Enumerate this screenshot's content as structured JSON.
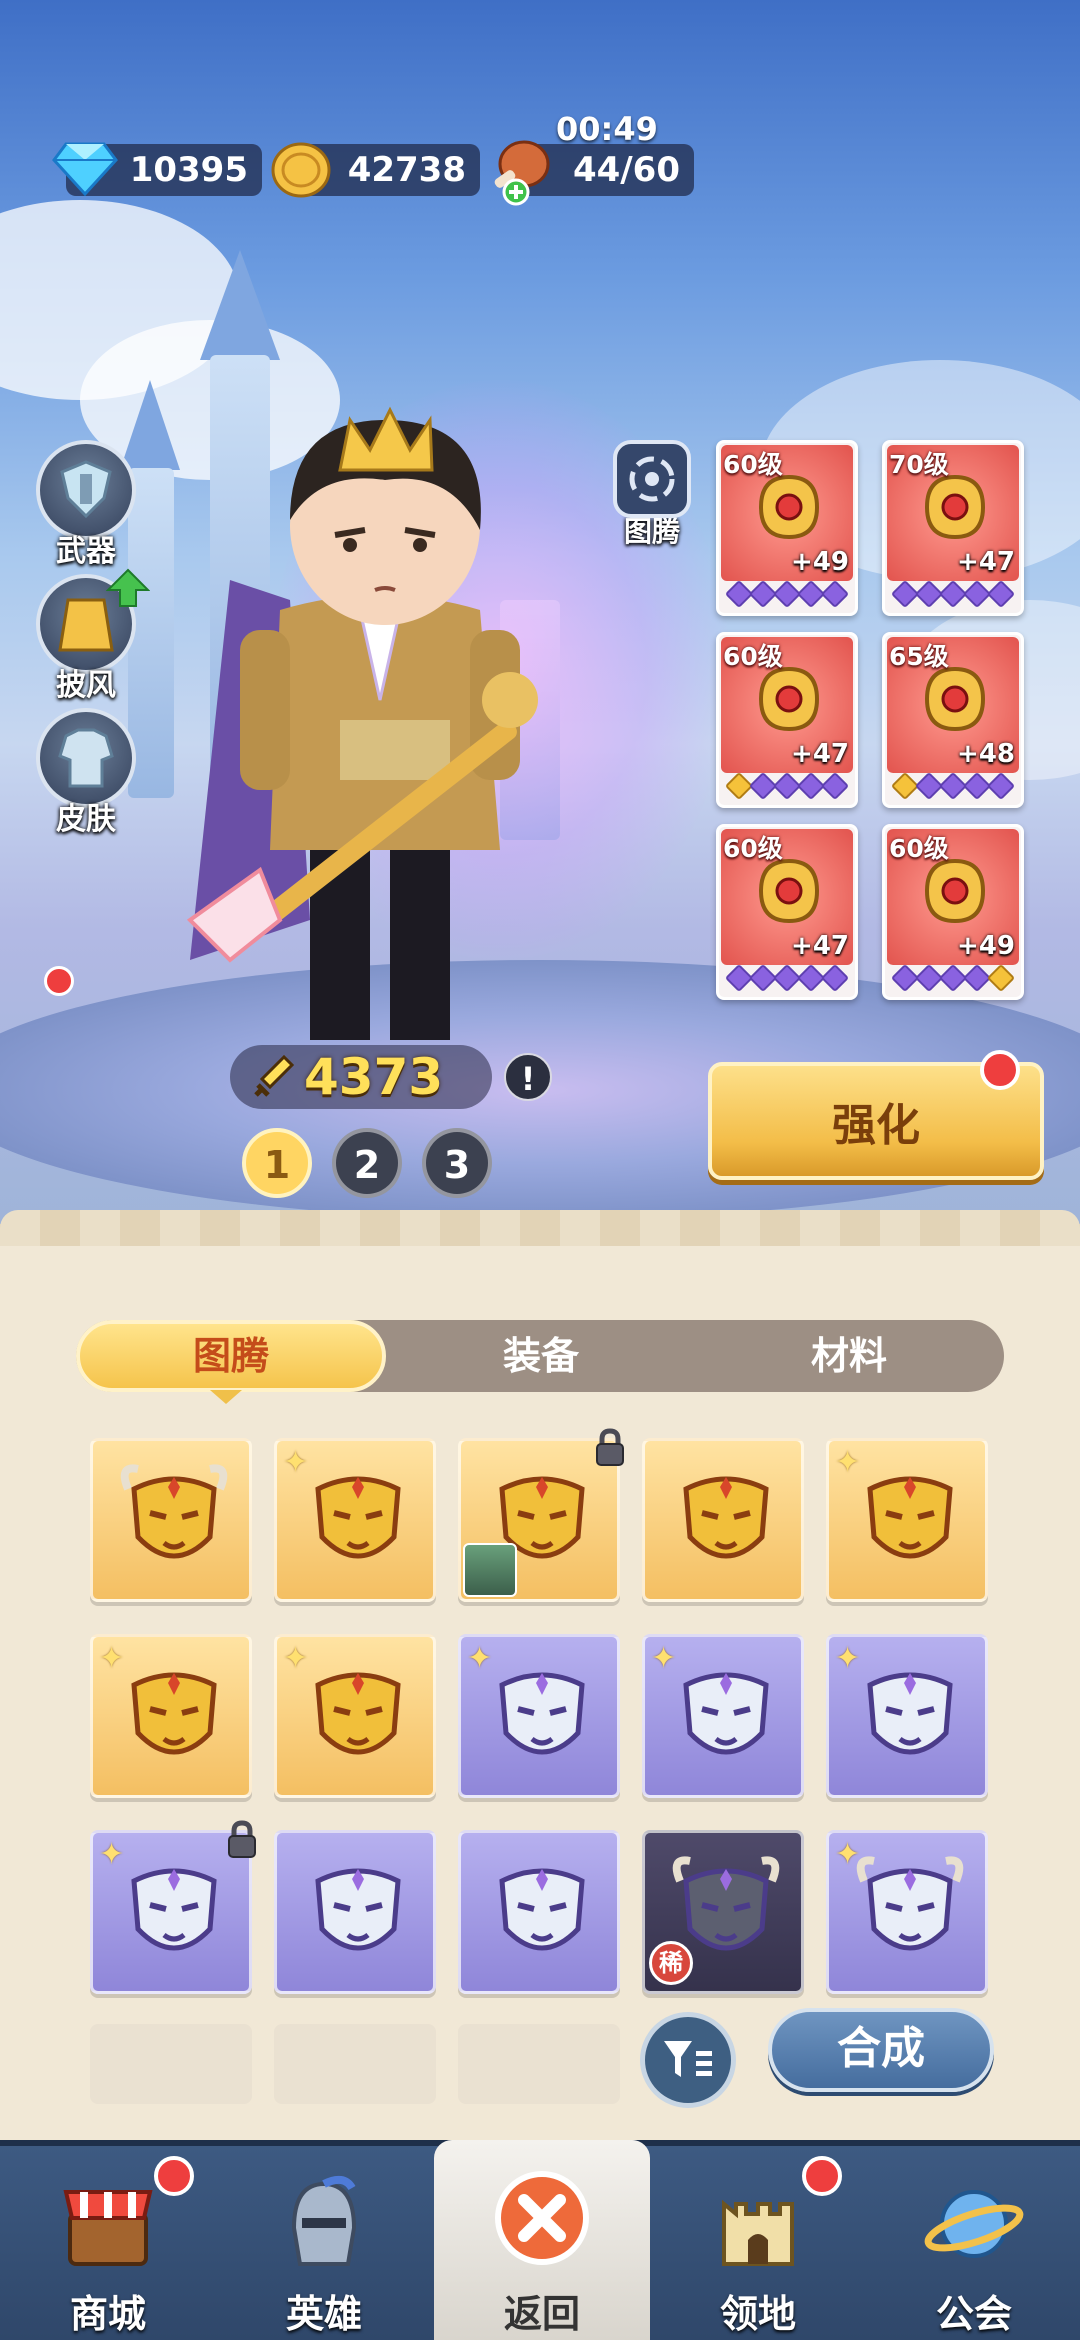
{
  "resources": {
    "gems": "10395",
    "coins": "42738",
    "stamina": "44/60",
    "stamina_timer": "00:49"
  },
  "side_menu": [
    {
      "label": "武器"
    },
    {
      "label": "披风"
    },
    {
      "label": "皮肤"
    }
  ],
  "totem_button": {
    "label": "图腾"
  },
  "equip_slots": [
    {
      "level": "60级",
      "plus": "+49",
      "pips": [
        "p",
        "p",
        "p",
        "p",
        "p"
      ],
      "icon": "jeweled-shoulder-icon"
    },
    {
      "level": "70级",
      "plus": "+47",
      "pips": [
        "p",
        "p",
        "p",
        "p",
        "p"
      ],
      "icon": "ruby-ring-icon"
    },
    {
      "level": "60级",
      "plus": "+47",
      "pips": [
        "g",
        "p",
        "p",
        "p",
        "p"
      ],
      "icon": "golden-crown-icon"
    },
    {
      "level": "65级",
      "plus": "+48",
      "pips": [
        "g",
        "p",
        "p",
        "p",
        "p"
      ],
      "icon": "golden-horn-icon"
    },
    {
      "level": "60级",
      "plus": "+47",
      "pips": [
        "p",
        "p",
        "p",
        "p",
        "p"
      ],
      "icon": "golden-boots-icon"
    },
    {
      "level": "60级",
      "plus": "+49",
      "pips": [
        "p",
        "p",
        "p",
        "p",
        "g"
      ],
      "icon": "golden-armor-icon"
    }
  ],
  "power": "4373",
  "info_mark": "!",
  "pages": [
    "1",
    "2",
    "3"
  ],
  "strengthen_label": "强化",
  "tabs": [
    "图腾",
    "装备",
    "材料"
  ],
  "inventory": [
    {
      "style": "gold",
      "star": false,
      "lock": false,
      "icon": "bull-skull-mask-icon"
    },
    {
      "style": "gold",
      "star": true,
      "lock": false,
      "icon": "phoenix-mask-icon"
    },
    {
      "style": "gold",
      "star": false,
      "lock": true,
      "icon": "owl-mask-icon",
      "portrait": true
    },
    {
      "style": "gold",
      "star": false,
      "lock": false,
      "icon": "owl-mask-icon"
    },
    {
      "style": "gold",
      "star": true,
      "lock": false,
      "icon": "owl-mask-icon"
    },
    {
      "style": "gold",
      "star": true,
      "lock": false,
      "icon": "dragon-mask-icon"
    },
    {
      "style": "gold",
      "star": true,
      "lock": false,
      "icon": "fox-mask-icon"
    },
    {
      "style": "purple",
      "star": true,
      "lock": false,
      "icon": "white-tiger-mask-icon"
    },
    {
      "style": "purple",
      "star": true,
      "lock": false,
      "icon": "white-tiger-mask-icon"
    },
    {
      "style": "purple",
      "star": true,
      "lock": false,
      "icon": "white-tiger-mask-icon"
    },
    {
      "style": "purple",
      "star": true,
      "lock": true,
      "icon": "white-tiger-mask-icon"
    },
    {
      "style": "purple",
      "star": false,
      "lock": false,
      "icon": "white-tiger-mask-icon"
    },
    {
      "style": "purple",
      "star": false,
      "lock": false,
      "icon": "white-tiger-mask-icon"
    },
    {
      "style": "dark",
      "star": false,
      "lock": false,
      "icon": "horned-helmet-mask-icon",
      "rare": "稀"
    },
    {
      "style": "purple",
      "star": true,
      "lock": false,
      "icon": "horned-bull-mask-icon"
    }
  ],
  "compose_label": "合成",
  "nav": [
    {
      "label": "商城",
      "badge": true,
      "icon": "shop-stall-icon"
    },
    {
      "label": "英雄",
      "badge": false,
      "icon": "knight-helmet-icon"
    },
    {
      "label": "返回",
      "badge": false,
      "icon": "close-icon",
      "active": true
    },
    {
      "label": "领地",
      "badge": true,
      "icon": "castle-tower-icon"
    },
    {
      "label": "公会",
      "badge": false,
      "icon": "planet-icon"
    }
  ],
  "colors": {
    "accent_gold": "#f5c44c",
    "badge_red": "#ee3e3e",
    "nav_bg": "#2f476a",
    "panel_bg": "#f1e8d6"
  }
}
